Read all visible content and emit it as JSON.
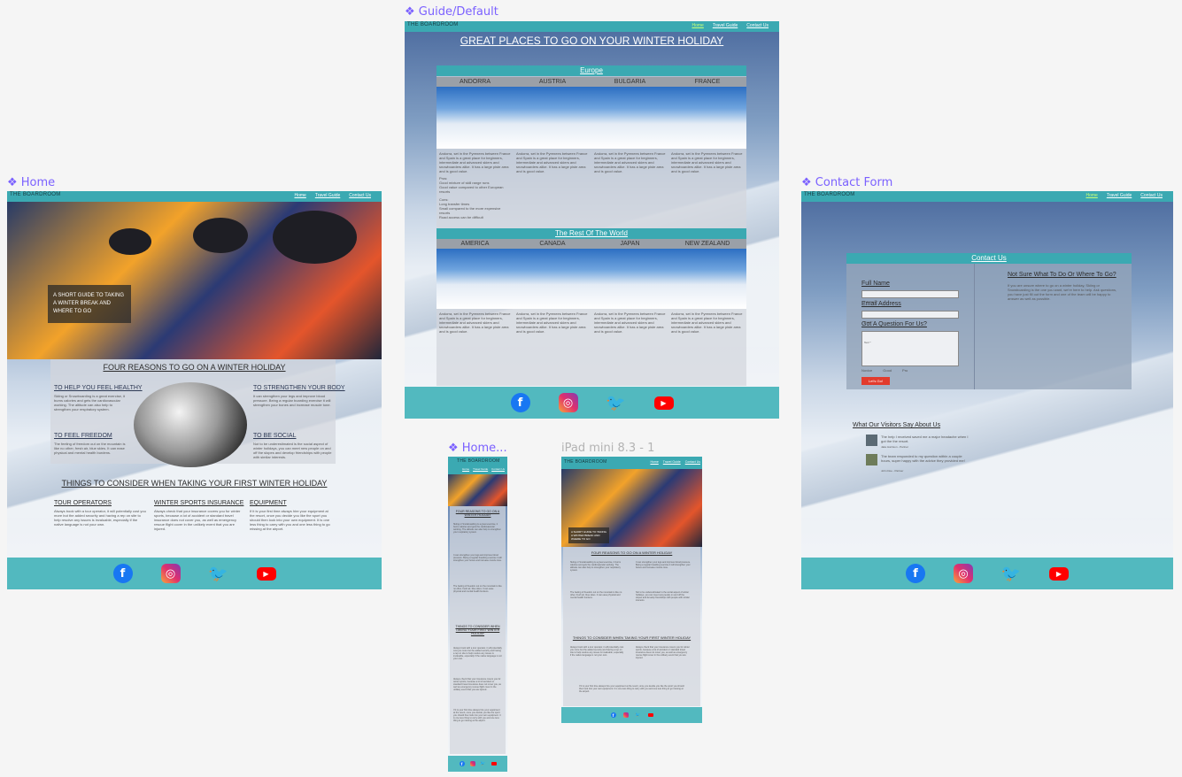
{
  "labels": {
    "home": "❖ Home",
    "guide": "❖ Guide/Default",
    "contact": "❖ Contact Form",
    "home_mobile": "❖ Home...",
    "ipad": "iPad mini 8.3 - 1"
  },
  "site": {
    "brand": "THE BOARDROOM",
    "nav": [
      "Home",
      "Travel Guide",
      "Contact Us"
    ]
  },
  "home": {
    "hero_caption": [
      "A SHORT GUIDE TO TAKING",
      "A WINTER BREAK AND",
      "WHERE TO GO"
    ],
    "reasons_title": "FOUR REASONS TO GO ON A WINTER HOLIDAY",
    "reasons": [
      {
        "title": "TO HELP YOU FEEL HEALTHY",
        "text": "Skiing or Snowboarding is a great exercise, it burns calories and gets the cardiovascular working. The altitude can also help to strengthen your respiratory system."
      },
      {
        "title": "TO STRENGTHEN YOUR BODY",
        "text": "It can strengthen your legs and improve blood pressure. Being a regular boarding exercise it will strengthen your bones and increase muscle tone."
      },
      {
        "title": "TO FEEL FREEDOM",
        "text": "The feeling of freedom out on the mountain is like no other, fresh air, blue skies. It can ease physical and mental health burdens."
      },
      {
        "title": "TO BE SOCIAL",
        "text": "Not to be underestimated is the social aspect of winter holidays, you can meet new people on and off the slopes and develop friendships with people with similar interests."
      }
    ],
    "consider_title": "THINGS TO CONSIDER WHEN TAKING YOUR FIRST WINTER HOLIDAY",
    "consider": [
      {
        "title": "TOUR OPERATORS",
        "text": "Always book with a tour operator, it will potentially cost you more but the added security and having a rep on site to help resolve any issues is invaluable, especially if the native language is not your own."
      },
      {
        "title": "WINTER SPORTS INSURANCE",
        "text": "Always check that your insurance covers you for winter sports, because a lot of accident or standard travel insurance does not cover you, as well as emergency rescue flight cover in the unlikely event that you are injured."
      },
      {
        "title": "EQUIPMENT",
        "text": "If it is your first time always hire your equipment at the resort, once you decide you like the sport you should then look into your own equipment. It is one less thing to carry with you and one less thing to go missing at the airport."
      }
    ]
  },
  "guide": {
    "title": "GREAT PLACES TO GO ON YOUR WINTER HOLIDAY",
    "europe_title": "Europe",
    "rest_title": "The Rest Of The World",
    "europe": [
      "ANDORRA",
      "AUSTRIA",
      "BULGARIA",
      "FRANCE"
    ],
    "rest": [
      "AMERICA",
      "CANADA",
      "JAPAN",
      "NEW ZEALAND"
    ],
    "card_text": "Andorra, set in the Pyrenees between France and Spain is a great place for beginners, intermediate and advanced skiers and snowboarders alike. It has a large piste area and is good value.",
    "pros_label": "Pros:",
    "pros": [
      "Good mixture of skill range runs",
      "Good value compared to other European resorts"
    ],
    "cons_label": "Cons:",
    "cons": [
      "Long transfer times",
      "Small compared to the more expensive resorts",
      "Road access can be difficult"
    ]
  },
  "contact": {
    "form_title": "Contact Us",
    "full_name_label": "Full Name",
    "full_name_placeholder": "Full Name *",
    "email_label": "Email Address",
    "email_placeholder": "Email *",
    "question_label": "Got A Question For Us?",
    "question_placeholder": "Text *",
    "radios": [
      "Novice",
      "Good",
      "Pro"
    ],
    "submit": "Let's Go!",
    "aside_title": "Not Sure What To Do Or Where To Go?",
    "aside_text": "If you are unsure where to go on a winter holiday, Skiing or Snowboarding is the one you want, we're here to help. Ask questions, you have just fill out the form and one of the team will be happy to answer as well as possible.",
    "testimonials_title": "What Our Visitors Say About Us",
    "testimonials": [
      {
        "quote": "The help I received saved me a major headache when I got the the resort.",
        "author": "Jake Harrison - Partner"
      },
      {
        "quote": "The team responded to my question within a couple hours, super happy with the advice they provided me!",
        "author": "John Doe - Partner"
      }
    ]
  },
  "mobile": {
    "reasons_title": "FOUR REASONS TO GO ON A WINTER HOLIDAY",
    "consider_title": "THINGS TO CONSIDER WHEN TAKING YOUR FIRST WINTER HOLIDAY"
  },
  "social": [
    "facebook-icon",
    "instagram-icon",
    "twitter-icon",
    "youtube-icon"
  ]
}
